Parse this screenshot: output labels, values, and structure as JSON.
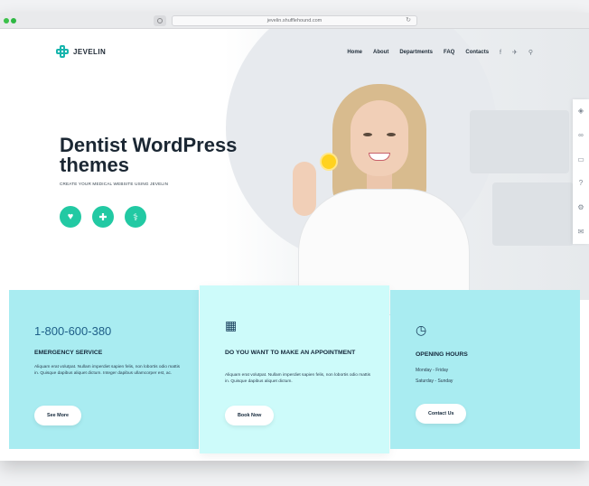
{
  "browser": {
    "url": "jevelin.shufflehound.com"
  },
  "header": {
    "logo_text": "JEVELIN",
    "nav": [
      "Home",
      "About",
      "Departments",
      "FAQ",
      "Contacts"
    ],
    "icons": [
      "facebook-icon",
      "twitter-icon",
      "search-icon"
    ]
  },
  "side_tools": [
    "layers-icon",
    "glasses-icon",
    "clipboard-icon",
    "help-icon",
    "settings-icon",
    "mail-icon"
  ],
  "hero": {
    "title": "Dentist WordPress themes",
    "subtitle": "CREATE YOUR MEDICAL WEBSITE USING JEVELIN",
    "icons": [
      "heart-pulse-icon",
      "first-aid-kit-icon",
      "stethoscope-icon"
    ]
  },
  "cards": {
    "emergency": {
      "phone": "1-800-600-380",
      "heading": "EMERGENCY SERVICE",
      "text": "Aliquam erat volutpat. Nullam imperdiet sapien felis, non lobortis odio mattis in. Quisque dapibus aliquet dictum. Integer dapibus ullamcorper est, ac.",
      "button": "See More"
    },
    "appointment": {
      "icon": "calendar-icon",
      "heading": "DO YOU WANT TO MAKE AN APPOINTMENT",
      "text": "Aliquam erat volutpat. Nullam imperdiet sapien felis, non lobortis odio mattis in. Quisque dapibus aliquet dictum.",
      "button": "Book Now"
    },
    "hours": {
      "icon": "clock-icon",
      "heading": "OPENING HOURS",
      "line1": "Monday - Friday",
      "line2": "Saturday - Sunday",
      "button": "Contact Us"
    }
  },
  "colors": {
    "accent": "#22c9a3",
    "logo": "#17b5ad",
    "card_blue": "#a9ecf1",
    "card_light": "#cdfbfa"
  }
}
